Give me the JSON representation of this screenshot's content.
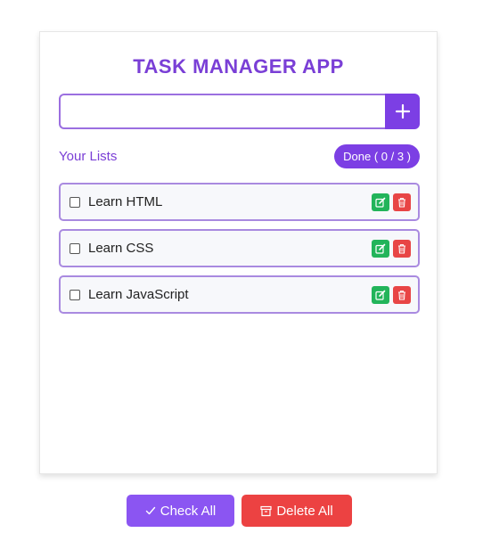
{
  "app": {
    "title": "TASK MANAGER APP"
  },
  "input": {
    "value": "",
    "placeholder": "",
    "add_icon": "plus-icon"
  },
  "list_header": {
    "label": "Your Lists",
    "done_text": "Done ( 0 / 3 )"
  },
  "tasks": [
    {
      "label": "Learn HTML",
      "checked": false
    },
    {
      "label": "Learn CSS",
      "checked": false
    },
    {
      "label": "Learn JavaScript",
      "checked": false
    }
  ],
  "actions": {
    "check_all": "Check All",
    "delete_all": "Delete All"
  },
  "colors": {
    "accent": "#7c3fe4",
    "edit": "#22b45a",
    "delete": "#e84545"
  }
}
